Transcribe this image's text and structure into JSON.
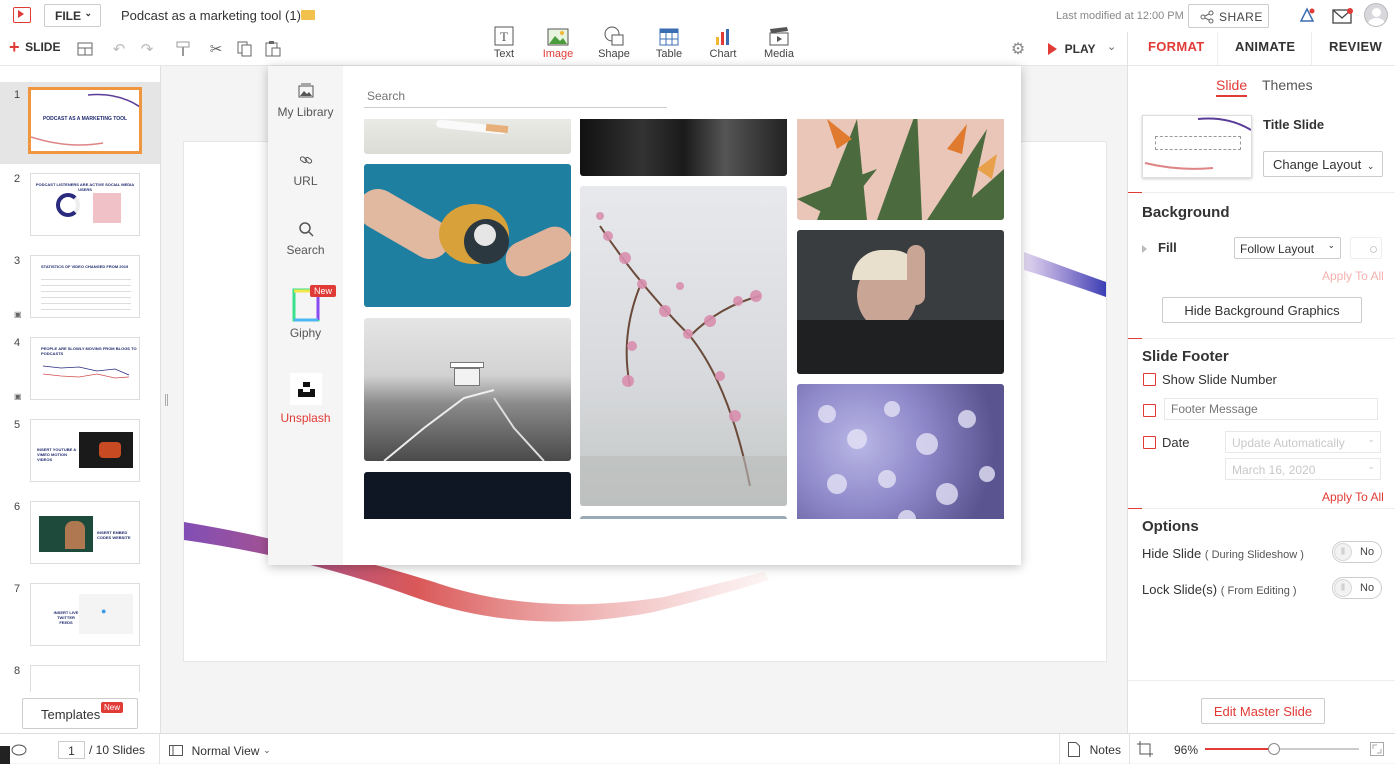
{
  "app": {
    "doc_title": "Podcast as a marketing tool (1)",
    "file_menu": "FILE",
    "last_modified": "Last modified at 12:00 PM",
    "share_label": "SHARE"
  },
  "toolbar": {
    "slide_label": "SLIDE",
    "insert": [
      {
        "label": "Text",
        "icon": "text-box-icon"
      },
      {
        "label": "Image",
        "icon": "image-icon"
      },
      {
        "label": "Shape",
        "icon": "shape-icon"
      },
      {
        "label": "Table",
        "icon": "table-icon"
      },
      {
        "label": "Chart",
        "icon": "chart-icon"
      },
      {
        "label": "Media",
        "icon": "media-icon"
      }
    ],
    "play_label": "PLAY"
  },
  "right_panel": {
    "tabs": [
      "FORMAT",
      "ANIMATE",
      "REVIEW"
    ],
    "subtabs": [
      "Slide",
      "Themes"
    ],
    "layout_name": "Title Slide",
    "change_layout": "Change Layout",
    "background": {
      "title": "Background",
      "fill_label": "Fill",
      "fill_value": "Follow Layout",
      "apply_all": "Apply To All",
      "hide_bg_button": "Hide Background Graphics"
    },
    "footer": {
      "title": "Slide Footer",
      "show_number": "Show Slide Number",
      "footer_placeholder": "Footer Message",
      "date_label": "Date",
      "date_mode": "Update Automatically",
      "date_value": "March 16, 2020",
      "apply_all": "Apply To All"
    },
    "options": {
      "title": "Options",
      "hide_slide": "Hide Slide",
      "hide_slide_note": "( During Slideshow )",
      "hide_value": "No",
      "lock_slide": "Lock Slide(s)",
      "lock_slide_note": "( From Editing )",
      "lock_value": "No"
    },
    "edit_master": "Edit Master Slide"
  },
  "slides": [
    {
      "num": "1",
      "title": "PODCAST AS A MARKETING TOOL"
    },
    {
      "num": "2",
      "title": "PODCAST LISTENERS ARE ACTIVE SOCIAL MEDIA USERS"
    },
    {
      "num": "3",
      "title": "STATISTICS OF VIDEO CHANGED FROM 2019"
    },
    {
      "num": "4",
      "title": "PEOPLE ARE SLOWLY MOVING FROM BLOGS TO PODCASTS"
    },
    {
      "num": "5",
      "title": "INSERT YOUTUBE & VIMEO MOTION VIDEOS"
    },
    {
      "num": "6",
      "title": "INSERT EMBED CODES WEBSITE"
    },
    {
      "num": "7",
      "title": "INSERT LIVE TWITTER FEEDS"
    },
    {
      "num": "8",
      "title": ""
    }
  ],
  "templates_label": "Templates",
  "new_badge": "New",
  "status": {
    "current_slide": "1",
    "total": "/ 10 Slides",
    "view": "Normal View",
    "notes": "Notes",
    "zoom": "96%",
    "zoom_level": 0.45
  },
  "image_picker": {
    "search_placeholder": "Search",
    "sources": [
      {
        "label": "My Library",
        "icon": "library-icon"
      },
      {
        "label": "URL",
        "icon": "link-icon"
      },
      {
        "label": "Search",
        "icon": "search-icon"
      },
      {
        "label": "Giphy",
        "icon": "giphy-icon",
        "badge": "New"
      },
      {
        "label": "Unsplash",
        "icon": "unsplash-icon"
      }
    ]
  }
}
